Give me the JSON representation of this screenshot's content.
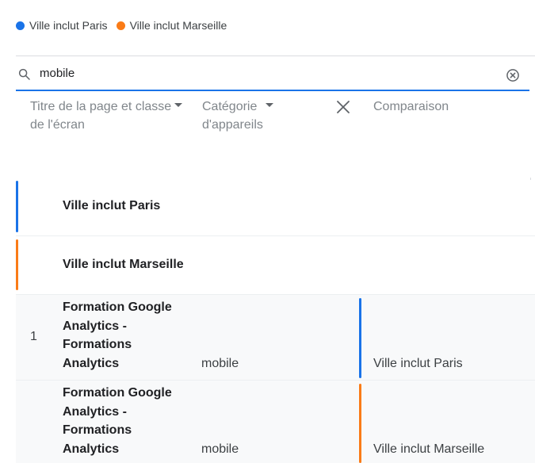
{
  "legend": {
    "items": [
      {
        "label": "Ville inclut Paris",
        "color": "#1a73e8"
      },
      {
        "label": "Ville inclut Marseille",
        "color": "#fa7b17"
      }
    ]
  },
  "search": {
    "value": "mobile",
    "icon": "search-icon",
    "clear_icon": "clear-circle-icon"
  },
  "columns": {
    "title": {
      "line1": "Titre de la page et classe",
      "line2": "de l'écran"
    },
    "category": {
      "line1": "Catégorie",
      "line2": "d'appareils"
    },
    "remove_icon": "close-icon",
    "comparison": "Comparaison"
  },
  "segments": [
    {
      "label": "Ville inclut Paris",
      "color": "#1a73e8"
    },
    {
      "label": "Ville inclut Marseille",
      "color": "#fa7b17"
    }
  ],
  "rows": [
    {
      "index": "1",
      "title_lines": [
        "Formation Google",
        "Analytics -",
        "Formations",
        "Analytics"
      ],
      "device": "mobile",
      "comparison": "Ville inclut Paris",
      "color": "#1a73e8"
    },
    {
      "index": "",
      "title_lines": [
        "Formation Google",
        "Analytics -",
        "Formations",
        "Analytics"
      ],
      "device": "mobile",
      "comparison": "Ville inclut Marseille",
      "color": "#fa7b17"
    }
  ]
}
